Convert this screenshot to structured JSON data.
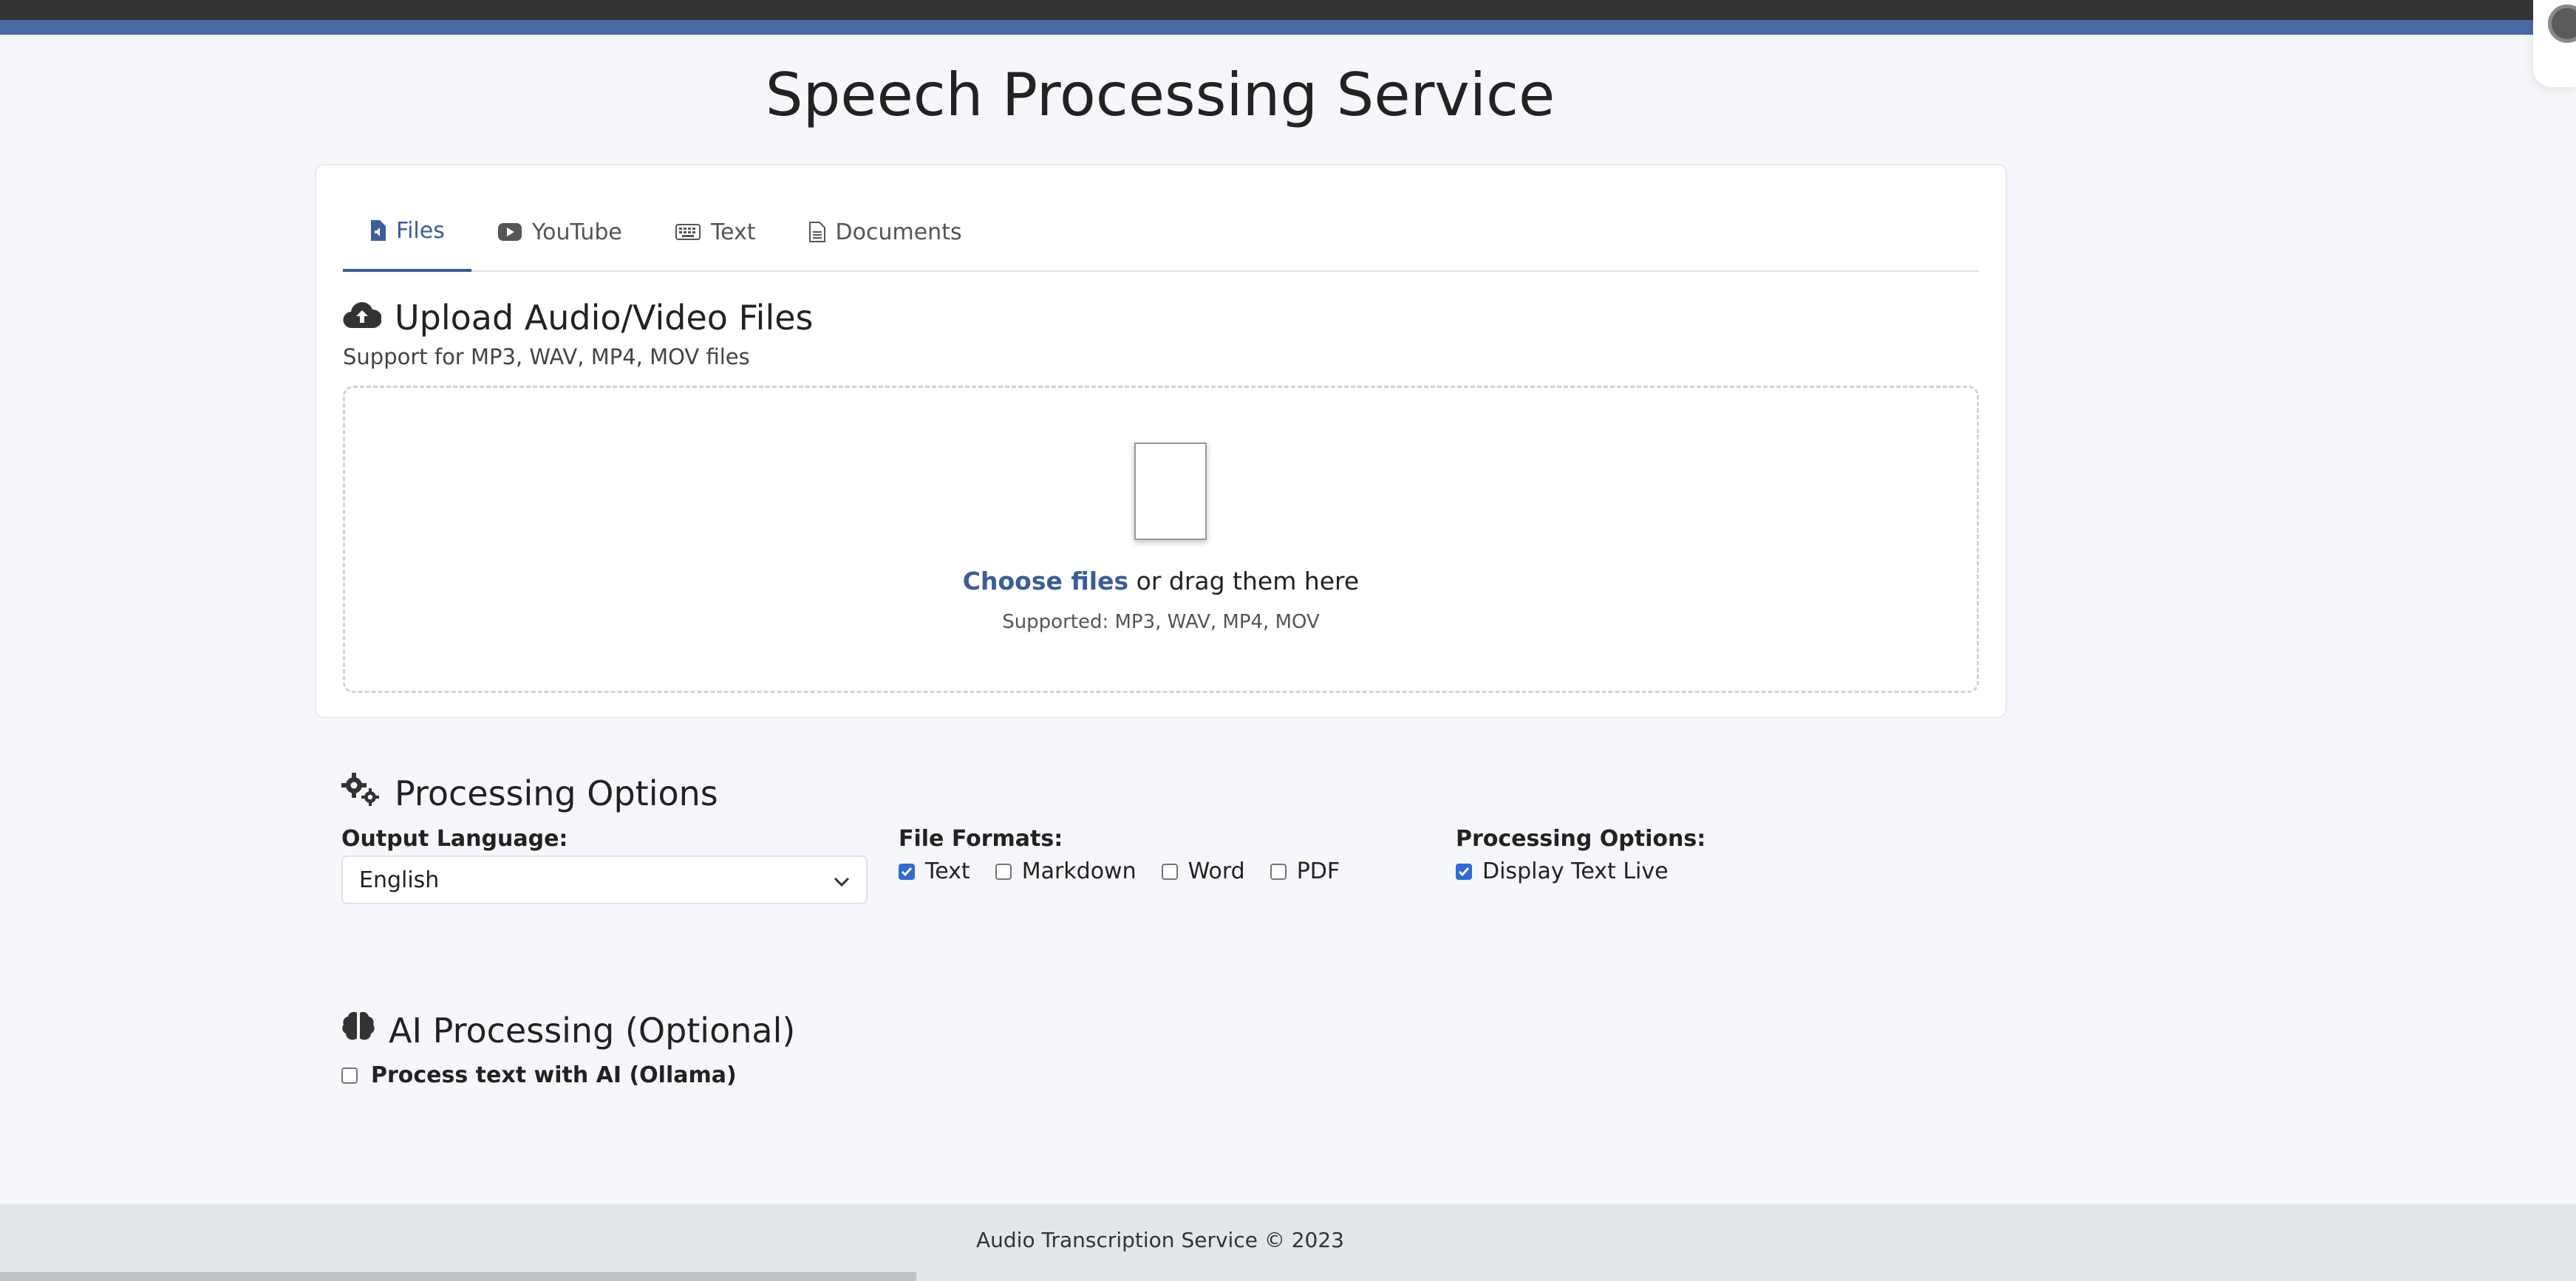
{
  "page": {
    "title": "Speech Processing Service"
  },
  "tabs": [
    {
      "label": "Files",
      "icon": "file-audio-icon",
      "active": true
    },
    {
      "label": "YouTube",
      "icon": "youtube-icon",
      "active": false
    },
    {
      "label": "Text",
      "icon": "keyboard-icon",
      "active": false
    },
    {
      "label": "Documents",
      "icon": "file-text-icon",
      "active": false
    }
  ],
  "upload": {
    "heading": "Upload Audio/Video Files",
    "icon": "cloud-upload-icon",
    "subtitle": "Support for MP3, WAV, MP4, MOV files",
    "choose_label": "Choose files",
    "drag_label": " or drag them here",
    "supported_note": "Supported: MP3, WAV, MP4, MOV"
  },
  "options": {
    "heading": "Processing Options",
    "icon": "gears-icon",
    "language_label": "Output Language:",
    "language_value": "English",
    "formats_label": "File Formats:",
    "formats": [
      {
        "label": "Text",
        "checked": true
      },
      {
        "label": "Markdown",
        "checked": false
      },
      {
        "label": "Word",
        "checked": false
      },
      {
        "label": "PDF",
        "checked": false
      }
    ],
    "processing_label": "Processing Options:",
    "display_live_label": "Display Text Live",
    "display_live_checked": true
  },
  "ai": {
    "heading": "AI Processing (Optional)",
    "icon": "brain-icon",
    "checkbox_label": "Process text with AI (Ollama)",
    "checked": false
  },
  "footer": {
    "text": "Audio Transcription Service © 2023"
  },
  "colors": {
    "accent": "#3b5d9a",
    "top_bar": "#4a6aa5",
    "background": "#f5f7fa"
  }
}
